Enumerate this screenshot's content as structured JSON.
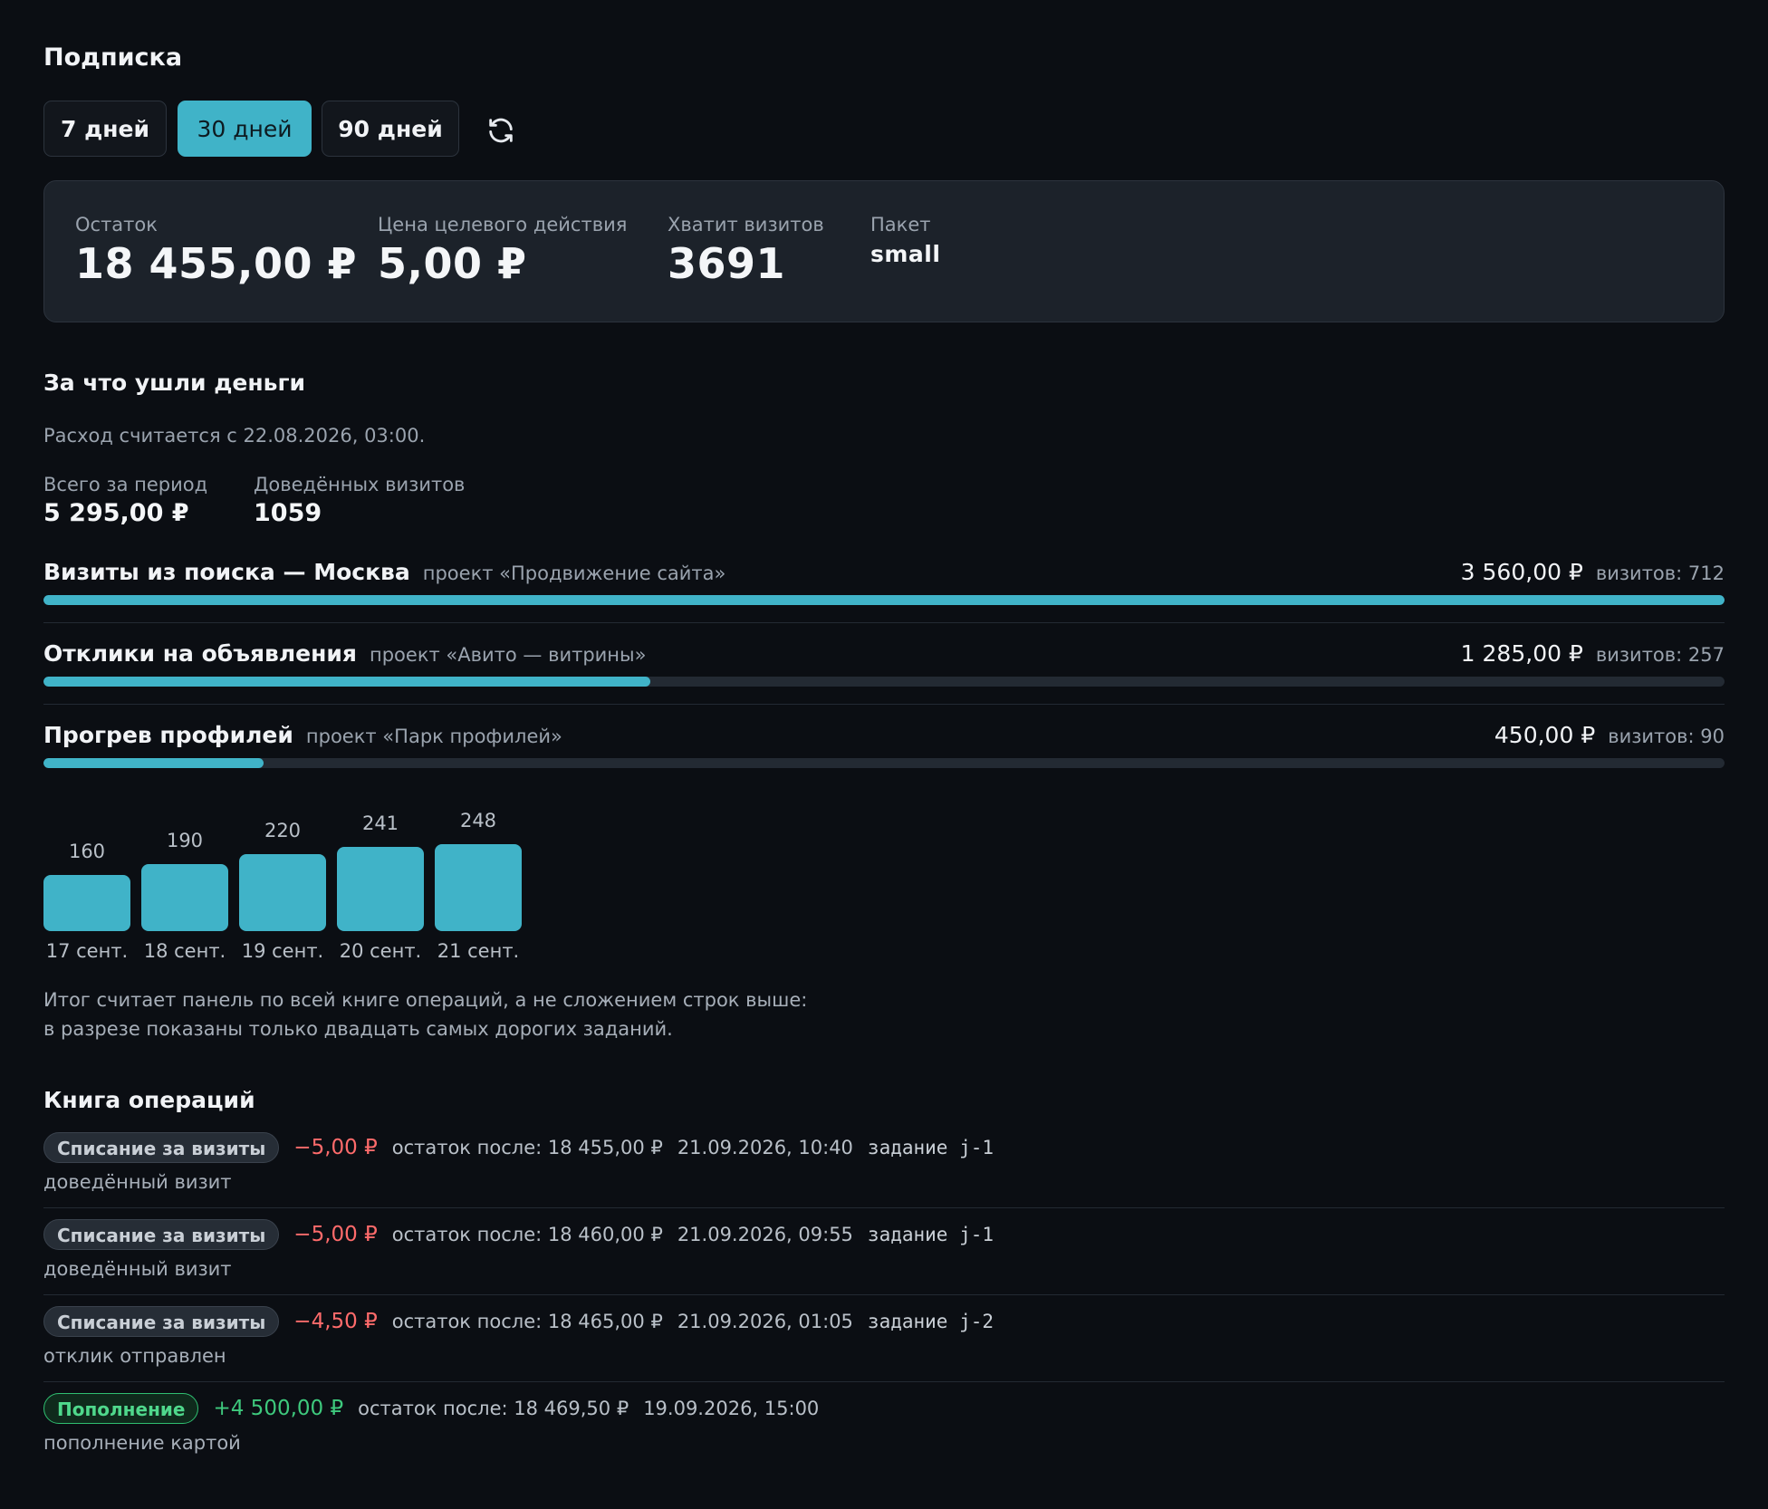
{
  "header": {
    "title": "Подписка"
  },
  "periods": {
    "items": [
      {
        "label": "7 дней",
        "active": false
      },
      {
        "label": "30 дней",
        "active": true
      },
      {
        "label": "90 дней",
        "active": false
      }
    ],
    "refresh_icon": "refresh-icon"
  },
  "stats": {
    "balance": {
      "label": "Остаток",
      "value": "18 455,00 ₽"
    },
    "price": {
      "label": "Цена целевого действия",
      "value": "5,00 ₽"
    },
    "visits": {
      "label": "Хватит визитов",
      "value": "3691"
    },
    "package": {
      "label": "Пакет",
      "value": "small"
    }
  },
  "spending": {
    "title": "За что ушли деньги",
    "since": "Расход считается с 22.08.2026, 03:00.",
    "total": {
      "label": "Всего за период",
      "value": "5 295,00 ₽"
    },
    "delivered": {
      "label": "Доведённых визитов",
      "value": "1059"
    },
    "categories": [
      {
        "name": "Визиты из поиска — Москва",
        "project": "проект «Продвижение сайта»",
        "amount": "3 560,00 ₽",
        "visits": "визитов: 712",
        "share": 1.0
      },
      {
        "name": "Отклики на объявления",
        "project": "проект «Авито — витрины»",
        "amount": "1 285,00 ₽",
        "visits": "визитов: 257",
        "share": 0.361
      },
      {
        "name": "Прогрев профилей",
        "project": "проект «Парк профилей»",
        "amount": "450,00 ₽",
        "visits": "визитов: 90",
        "share": 0.131
      }
    ],
    "note": "Итог считает панель по всей книге операций, а не сложением строк выше: в разрезе показаны только двадцать самых дорогих заданий."
  },
  "chart_data": {
    "type": "bar",
    "categories": [
      "17 сент.",
      "18 сент.",
      "19 сент.",
      "20 сент.",
      "21 сент."
    ],
    "values": [
      160,
      190,
      220,
      241,
      248
    ],
    "title": "",
    "xlabel": "",
    "ylabel": ""
  },
  "ledger": {
    "title": "Книга операций",
    "items": [
      {
        "type": "Списание за визиты",
        "kind": "debit",
        "amount": "−5,00 ₽",
        "after": "остаток после: 18 455,00 ₽",
        "time": "21.09.2026, 10:40",
        "job": "задание j-1",
        "desc": "доведённый визит"
      },
      {
        "type": "Списание за визиты",
        "kind": "debit",
        "amount": "−5,00 ₽",
        "after": "остаток после: 18 460,00 ₽",
        "time": "21.09.2026, 09:55",
        "job": "задание j-1",
        "desc": "доведённый визит"
      },
      {
        "type": "Списание за визиты",
        "kind": "debit",
        "amount": "−4,50 ₽",
        "after": "остаток после: 18 465,00 ₽",
        "time": "21.09.2026, 01:05",
        "job": "задание j-2",
        "desc": "отклик отправлен"
      },
      {
        "type": "Пополнение",
        "kind": "credit",
        "amount": "+4 500,00 ₽",
        "after": "остаток после: 18 469,50 ₽",
        "time": "19.09.2026, 15:00",
        "job": "",
        "desc": "пополнение картой"
      }
    ]
  },
  "colors": {
    "accent": "#40b3c8",
    "negative": "#ff6b6b",
    "positive": "#3ec97d",
    "background": "#0b0e13"
  }
}
